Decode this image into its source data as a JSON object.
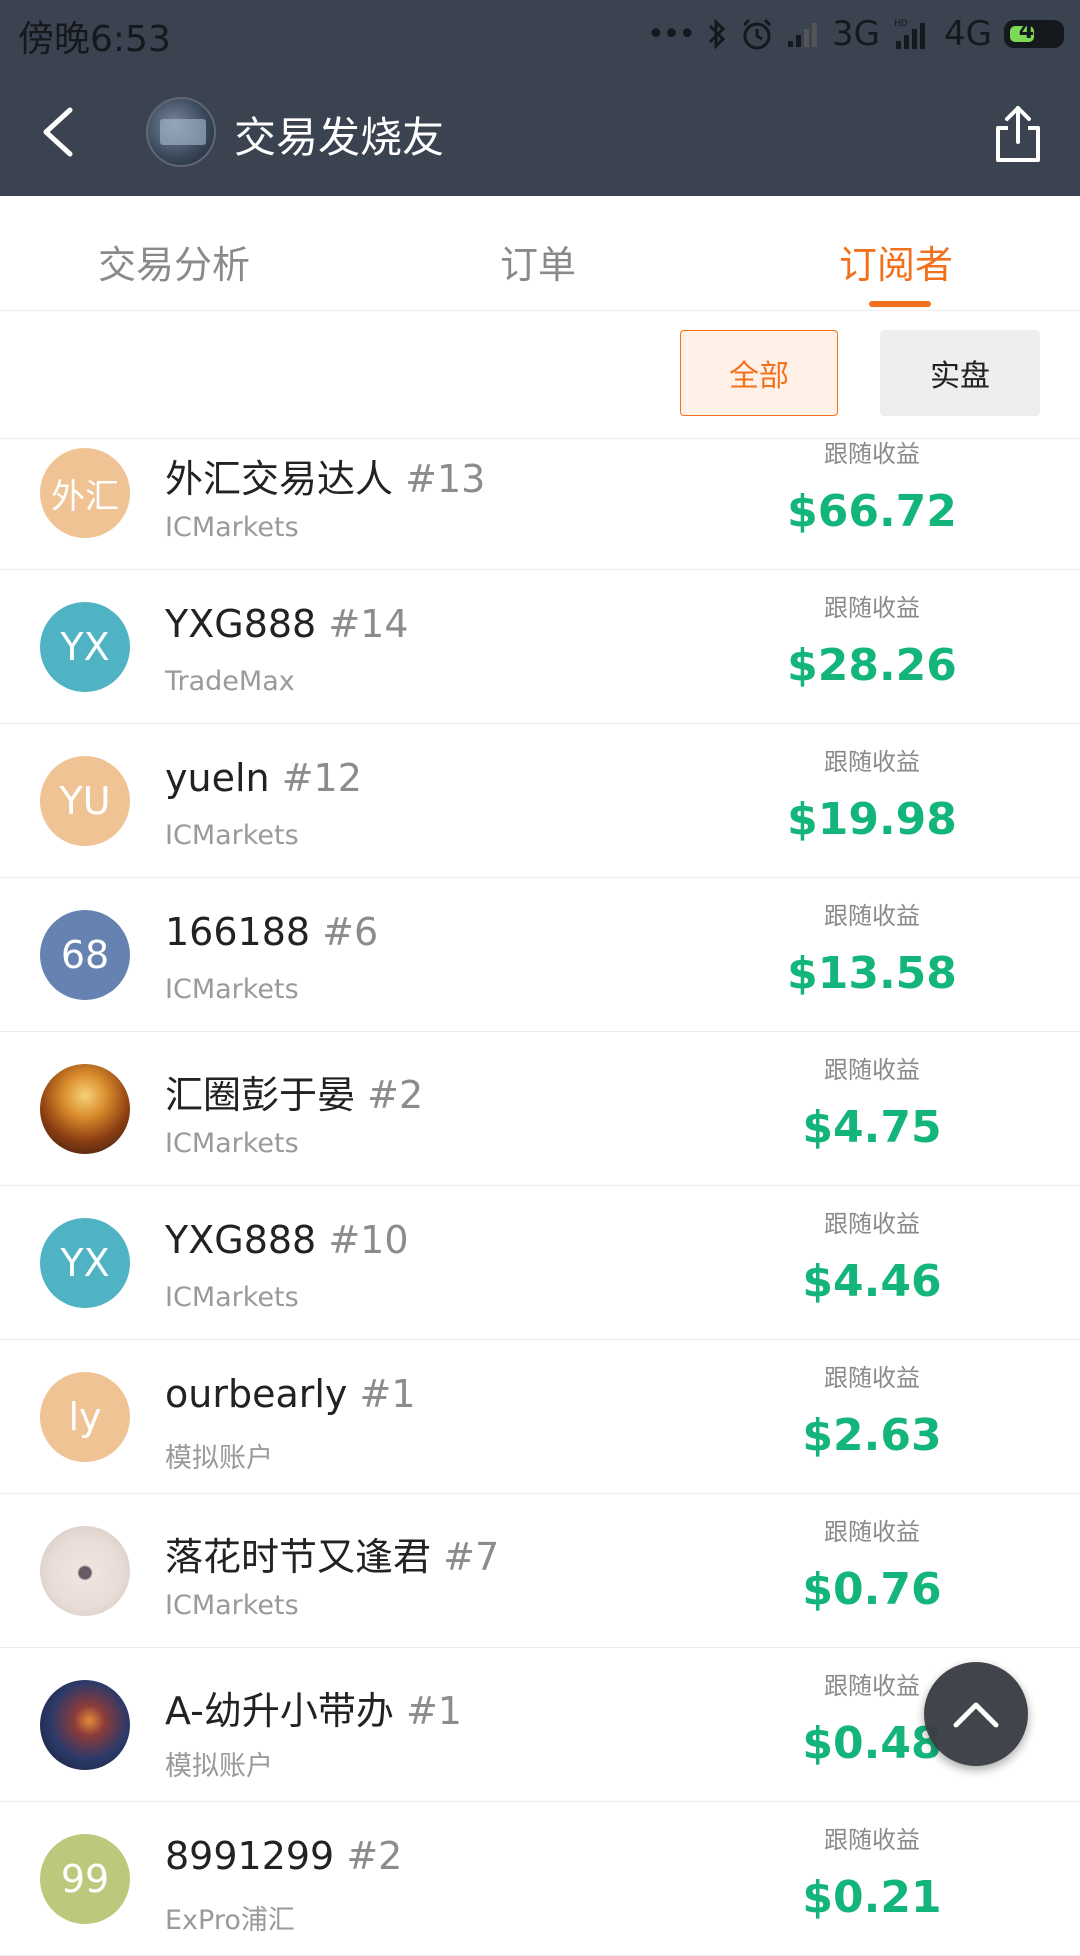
{
  "status_bar": {
    "time": "傍晚6:53",
    "signal_1": "3G",
    "signal_2": "4G",
    "battery": "49",
    "battery_fraction": 0.49
  },
  "header": {
    "title": "交易发烧友",
    "back_icon": "chevron-left-icon",
    "share_icon": "share-icon"
  },
  "tabs": [
    {
      "label": "交易分析",
      "active": false
    },
    {
      "label": "订单",
      "active": false
    },
    {
      "label": "订阅者",
      "active": true
    }
  ],
  "filters": {
    "all": "全部",
    "real": "实盘",
    "selected": "全部"
  },
  "colors": {
    "accent": "#f2711c",
    "gain": "#13b57a",
    "header_bg": "#3c4350"
  },
  "subscribers": [
    {
      "avatar_text": "外汇",
      "avatar_color": "#efc394",
      "name": "外汇交易达人",
      "rank": "#13",
      "broker": "ICMarkets",
      "gain_label": "跟随收益",
      "gain": "$66.72"
    },
    {
      "avatar_text": "YX",
      "avatar_color": "#4fb3c4",
      "name": "YXG888",
      "rank": "#14",
      "broker": "TradeMax",
      "gain_label": "跟随收益",
      "gain": "$28.26"
    },
    {
      "avatar_text": "YU",
      "avatar_color": "#efc394",
      "name": "yueln",
      "rank": "#12",
      "broker": "ICMarkets",
      "gain_label": "跟随收益",
      "gain": "$19.98"
    },
    {
      "avatar_text": "68",
      "avatar_color": "#6582b0",
      "name": "166188",
      "rank": "#6",
      "broker": "ICMarkets",
      "gain_label": "跟随收益",
      "gain": "$13.58"
    },
    {
      "avatar_text": "",
      "avatar_color": "#c36a1c",
      "name": "汇圈彭于晏",
      "rank": "#2",
      "broker": "ICMarkets",
      "gain_label": "跟随收益",
      "gain": "$4.75"
    },
    {
      "avatar_text": "YX",
      "avatar_color": "#4fb3c4",
      "name": "YXG888",
      "rank": "#10",
      "broker": "ICMarkets",
      "gain_label": "跟随收益",
      "gain": "$4.46"
    },
    {
      "avatar_text": "ly",
      "avatar_color": "#efc394",
      "name": "ourbearly",
      "rank": "#1",
      "broker": "模拟账户",
      "gain_label": "跟随收益",
      "gain": "$2.63"
    },
    {
      "avatar_text": "",
      "avatar_color": "#e6d8d2",
      "name": "落花时节又逢君",
      "rank": "#7",
      "broker": "ICMarkets",
      "gain_label": "跟随收益",
      "gain": "$0.76"
    },
    {
      "avatar_text": "",
      "avatar_color": "#2a3558",
      "name": "A-幼升小带办",
      "rank": "#1",
      "broker": "模拟账户",
      "gain_label": "跟随收益",
      "gain": "$0.48"
    },
    {
      "avatar_text": "99",
      "avatar_color": "#bcc97c",
      "name": "8991299",
      "rank": "#2",
      "broker": "ExPro浦汇",
      "gain_label": "跟随收益",
      "gain": "$0.21"
    }
  ],
  "scroll_top_icon": "chevron-up-icon"
}
